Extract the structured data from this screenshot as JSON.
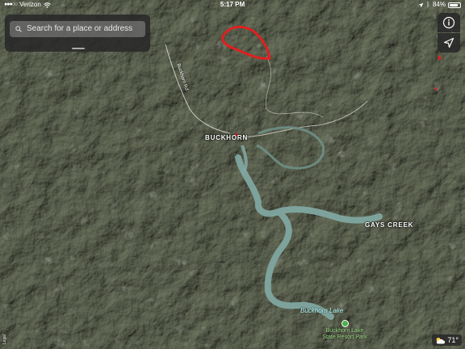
{
  "status_bar": {
    "carrier": "Verizon",
    "time": "5:17 PM",
    "battery": "84%",
    "battery_level": 0.84
  },
  "search": {
    "placeholder": "Search for a place or address"
  },
  "controls": {
    "info_icon": "info-icon",
    "location_icon": "location-arrow-icon"
  },
  "map": {
    "map_type": "satellite",
    "town_label": "BUCKHORN",
    "community_label": "GAYS CREEK",
    "road_label": "Buckhorn Rd",
    "lake_label": "Buckhorn Lake",
    "poi_label": "Buckhorn Lake State Resort Park",
    "highlight_color": "#e02020",
    "water_color": "#7fa6a0",
    "poi_color": "#4db04a"
  },
  "weather": {
    "temperature": "71°",
    "icon": "partly-cloudy-icon"
  }
}
